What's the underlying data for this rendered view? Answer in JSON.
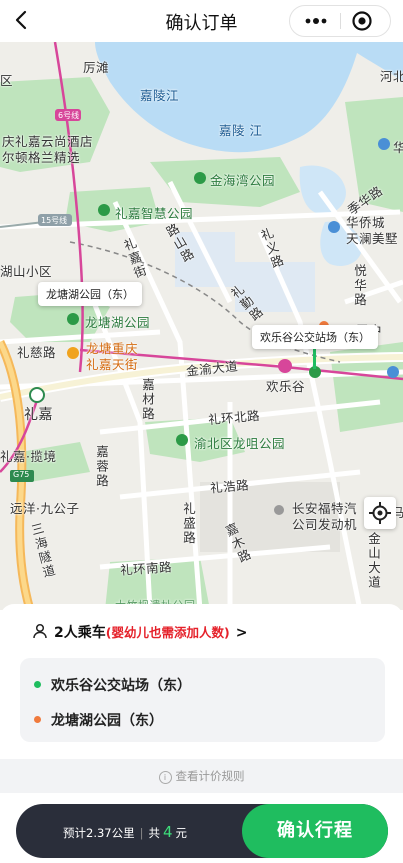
{
  "nav": {
    "title": "确认订单",
    "back_icon": "chevron-left-icon",
    "menu_icon": "more-dots-icon",
    "close_icon": "target-circle-icon"
  },
  "map": {
    "labels": {
      "lizi_district": "区",
      "houtan": "厉滩",
      "jialing_river_1": "嘉陵江",
      "jialing_river_2": "嘉陵 江",
      "hebei": "河北",
      "hotel_1": "庆礼嘉云尚酒店",
      "hotel_2": "尔顿格兰精选",
      "hua": "华",
      "jinhaiwan_park": "金海湾公园",
      "jixue_road": "季华路",
      "line6_badge": "6号线",
      "line15_badge": "15号线",
      "lijia_zhihui_park": "礼嘉智慧公园",
      "huaqiao_city_1": "华侨城",
      "huaqiao_city_2": "天澜美墅",
      "lijia_street": "礼嘉街",
      "lushan_road": "路山路",
      "liyi_road": "礼义路",
      "xiaoqu": "湖山小区",
      "yuehua_road": "悦华路",
      "longtang_lake_park": "龙塘湖公园",
      "liqin_road": "礼勤路",
      "shu_zhong": "蜀中",
      "liqing_road": "礼慈路",
      "longtang_chongqing_1": "龙塘重庆",
      "longtang_chongqing_2": "礼嘉天街",
      "jinyu_avenue": "金渝大道",
      "huanlegu": "欢乐谷",
      "lijia": "礼嘉",
      "jiacai_road": "嘉材路",
      "lihuanbei_road": "礼环北路",
      "lijing": "礼嘉·揽境",
      "yubei_longjiu_park": "渝北区龙咀公园",
      "jiarong_road": "嘉蓉路",
      "g75": "G75",
      "yuanyang": "远洋·九公子",
      "lihao_road": "礼浩路",
      "changan_1": "长安福特汽",
      "changan_2": "公司发动机",
      "sanhai_tunnel": "三海隧道",
      "lisheng_road": "礼盛路",
      "jiamu_road": "嘉木路",
      "jinshan_avenue": "金山大道",
      "lihuannan_road": "礼环南路",
      "bottom_partial": "大竹坝遗址公园",
      "ma": "马"
    },
    "callout_destination": "龙塘湖公园（东）",
    "callout_origin": "欢乐谷公交站场（东）",
    "colors": {
      "water": "#b9dcf5",
      "park": "#bfe4bd",
      "metro_line": "#d7469a",
      "highway": "#f5b85a"
    },
    "locate_icon": "crosshair-locate-icon"
  },
  "sheet": {
    "passenger_icon": "person-icon",
    "passenger_count": "2人乘车",
    "passenger_warning": "(婴幼儿也需添加人数)",
    "passenger_chevron": ">",
    "origin": "欢乐谷公交站场（东）",
    "destination": "龙塘湖公园（东）",
    "origin_color": "#1fbd5f",
    "destination_color": "#f07a3c",
    "price_rule": "查看计价规则",
    "estimate_distance": "预计2.37公里",
    "estimate_sep": "|",
    "estimate_prefix": "共",
    "estimate_amount": "4",
    "estimate_unit": "元",
    "confirm_label": "确认行程"
  }
}
